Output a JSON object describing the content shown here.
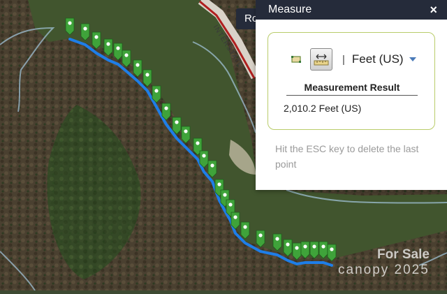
{
  "map": {
    "road_label": "INTERSTATE",
    "markers": [
      [
        100,
        38
      ],
      [
        122,
        46
      ],
      [
        138,
        58
      ],
      [
        155,
        68
      ],
      [
        169,
        74
      ],
      [
        181,
        84
      ],
      [
        197,
        98
      ],
      [
        211,
        112
      ],
      [
        224,
        135
      ],
      [
        238,
        160
      ],
      [
        253,
        180
      ],
      [
        266,
        193
      ],
      [
        283,
        210
      ],
      [
        292,
        228
      ],
      [
        304,
        242
      ],
      [
        314,
        269
      ],
      [
        322,
        284
      ],
      [
        330,
        298
      ],
      [
        337,
        316
      ],
      [
        351,
        330
      ],
      [
        373,
        342
      ],
      [
        397,
        347
      ],
      [
        412,
        355
      ],
      [
        425,
        360
      ],
      [
        437,
        358
      ],
      [
        450,
        358
      ],
      [
        463,
        358
      ],
      [
        475,
        362
      ]
    ],
    "route_color": "#1e7ee8",
    "marker_color": "#3fa33a"
  },
  "partial_button": {
    "label": "Ro"
  },
  "panel": {
    "title": "Measure",
    "close_icon": "×",
    "unit": "Feet (US)",
    "separator": "|",
    "result_heading": "Measurement Result",
    "result_value": "2,010.2 Feet (US)",
    "hint": "Hit the ESC key to delete the last point"
  },
  "watermark": {
    "line1": "For Sale",
    "line2": "canopy 2025"
  }
}
